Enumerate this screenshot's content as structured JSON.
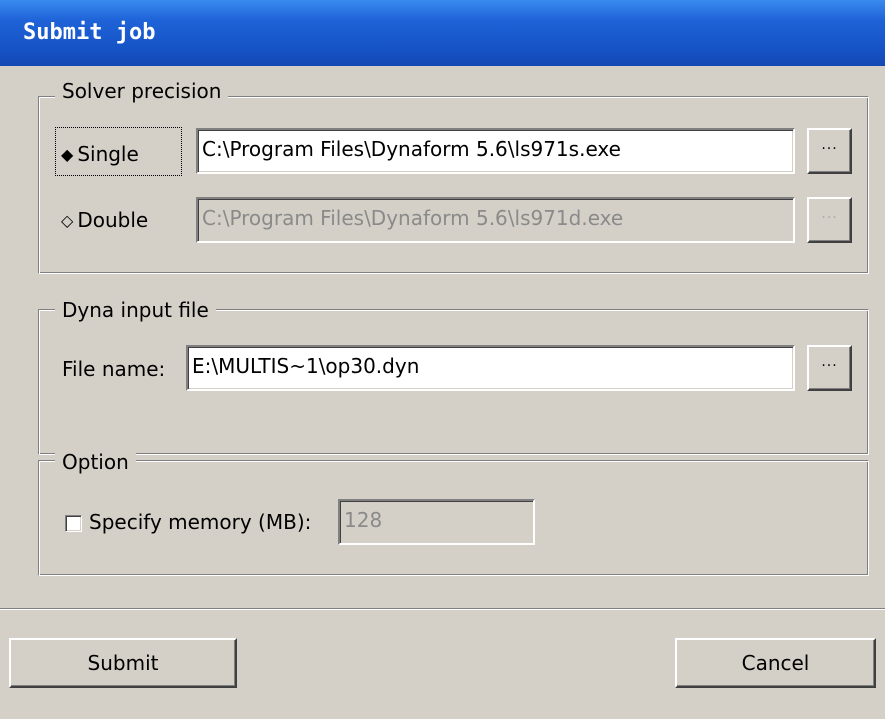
{
  "window": {
    "title": "Submit job"
  },
  "solver_precision": {
    "group_label": "Solver precision",
    "single": {
      "label": "Single",
      "selected": true,
      "path": "C:\\Program Files\\Dynaform 5.6\\ls971s.exe",
      "browse_label": "..."
    },
    "double": {
      "label": "Double",
      "selected": false,
      "path": "C:\\Program Files\\Dynaform 5.6\\ls971d.exe",
      "browse_label": "..."
    }
  },
  "dyna_input": {
    "group_label": "Dyna input file",
    "file_label": "File name:",
    "file_value": "E:\\MULTIS~1\\op30.dyn",
    "browse_label": "..."
  },
  "option": {
    "group_label": "Option",
    "memory_label": "Specify memory (MB):",
    "memory_checked": false,
    "memory_value": "128"
  },
  "buttons": {
    "submit": "Submit",
    "cancel": "Cancel"
  },
  "icons": {
    "radio_selected": "◆",
    "radio_unselected": "◇"
  }
}
